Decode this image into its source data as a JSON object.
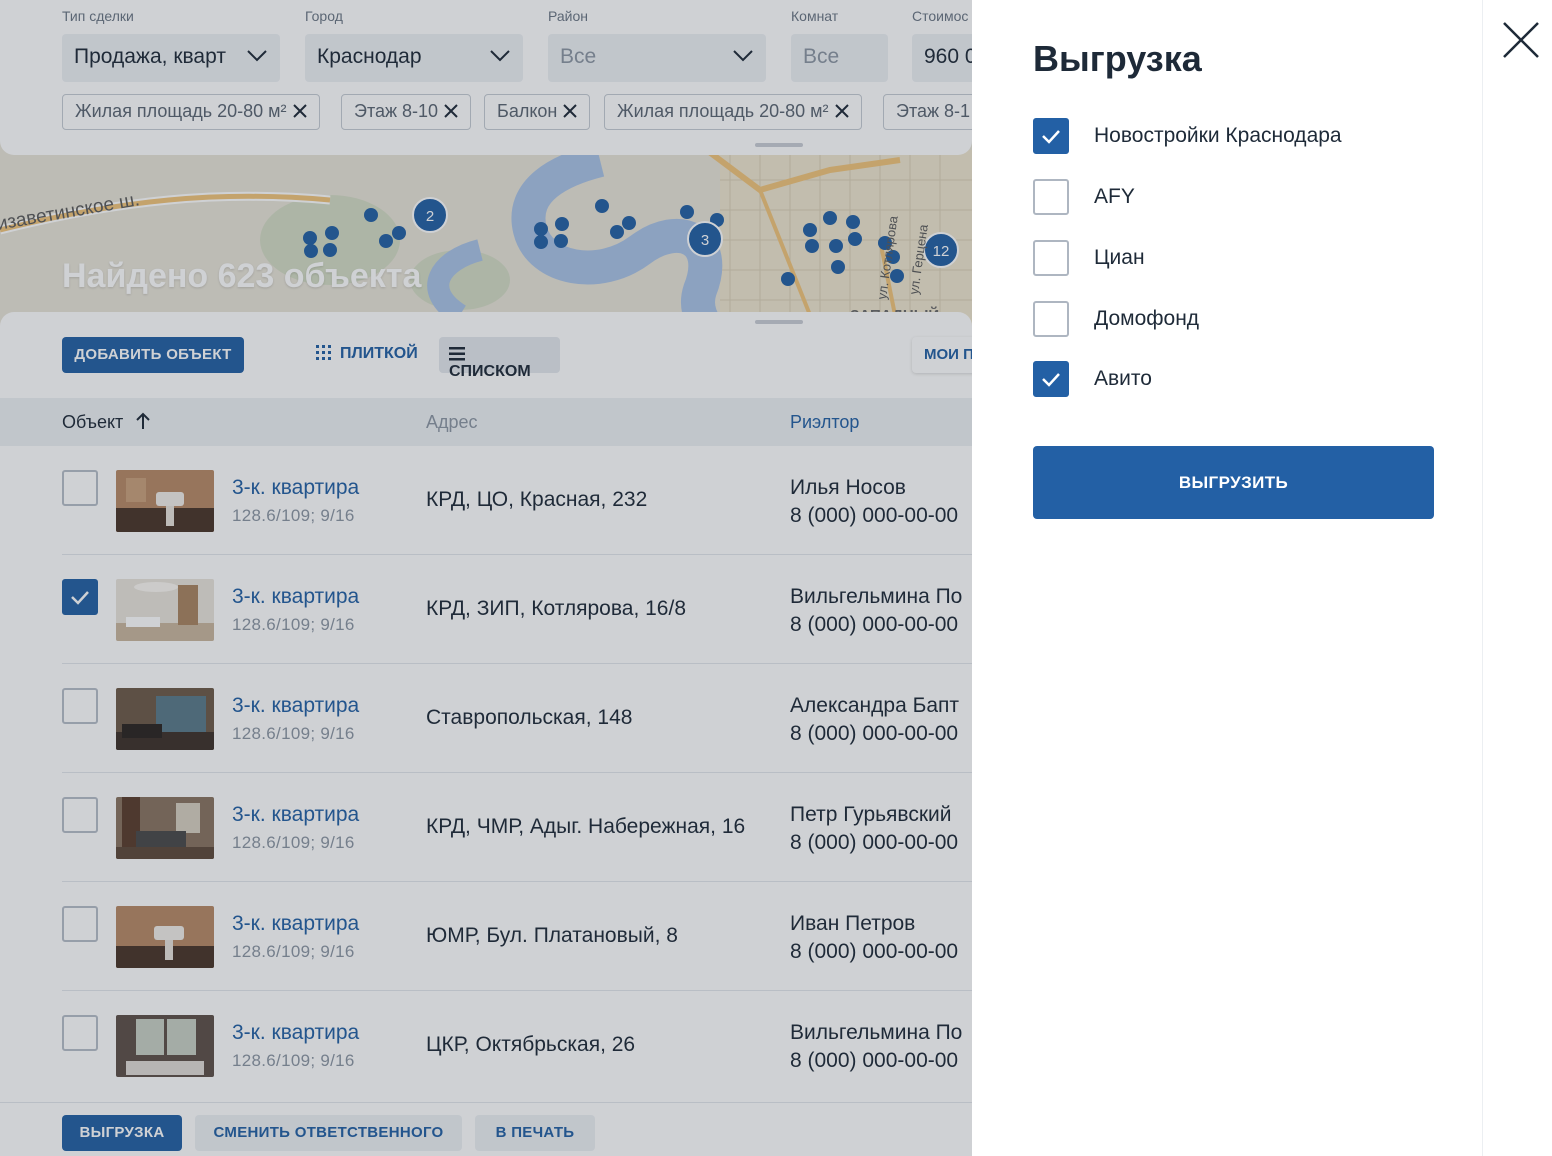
{
  "filters": {
    "deal_type": {
      "label": "Тип сделки",
      "value": "Продажа, кварт"
    },
    "city": {
      "label": "Город",
      "value": "Краснодар"
    },
    "district": {
      "label": "Район",
      "value": "Все"
    },
    "rooms": {
      "label": "Комнат",
      "value": "Все"
    },
    "price": {
      "label": "Стоимос",
      "value": "960 0"
    },
    "chips": [
      "Жилая площадь 20-80 м²",
      "Этаж 8-10",
      "Балкон",
      "Жилая площадь 20-80 м²",
      "Этаж 8-1"
    ]
  },
  "map": {
    "street_label": "изаветинское ш.",
    "street_label_2": "ул. Котлярова",
    "street_label_3": "ул. Герцена",
    "district_label": "ЗАПАДНЫЙ",
    "clusters": [
      "2",
      "3",
      "12"
    ]
  },
  "found_text": "Найдено 623 объекта",
  "toolbar": {
    "add_object": "ДОБАВИТЬ ОБЪЕКТ",
    "view_tiles": "ПЛИТКОЙ",
    "view_list": "СПИСКОМ",
    "my_label": "МОИ П"
  },
  "table": {
    "columns": {
      "object": "Объект",
      "address": "Адрес",
      "realtor": "Риэлтор"
    },
    "rows": [
      {
        "title": "3-к. квартира",
        "sub": "128.6/109; 9/16",
        "address": "КРД, ЦО, Красная, 232",
        "realtor": "Илья Носов",
        "phone": "8 (000) 000-00-00",
        "checked": false
      },
      {
        "title": "3-к. квартира",
        "sub": "128.6/109; 9/16",
        "address": "КРД, ЗИП, Котлярова, 16/8",
        "realtor": "Вильгельмина По",
        "phone": "8 (000) 000-00-00",
        "checked": true
      },
      {
        "title": "3-к. квартира",
        "sub": "128.6/109; 9/16",
        "address": "Ставропольская, 148",
        "realtor": "Александра Бапт",
        "phone": "8 (000) 000-00-00",
        "checked": false
      },
      {
        "title": "3-к. квартира",
        "sub": "128.6/109; 9/16",
        "address": "КРД, ЧМР, Адыг. Набережная, 16",
        "realtor": "Петр Гурьявский",
        "phone": "8 (000) 000-00-00",
        "checked": false
      },
      {
        "title": "3-к. квартира",
        "sub": "128.6/109; 9/16",
        "address": "ЮМР, Бул. Платановый, 8",
        "realtor": "Иван Петров",
        "phone": "8 (000) 000-00-00",
        "checked": false
      },
      {
        "title": "3-к. квартира",
        "sub": "128.6/109; 9/16",
        "address": "ЦКР, Октябрьская, 26",
        "realtor": "Вильгельмина По",
        "phone": "8 (000) 000-00-00",
        "checked": false
      }
    ]
  },
  "bottom": {
    "export": "ВЫГРУЗКА",
    "change_responsible": "СМЕНИТЬ ОТВЕТСТВЕННОГО",
    "print": "В ПЕЧАТЬ"
  },
  "drawer": {
    "title": "Выгрузка",
    "options": [
      {
        "label": "Новостройки Краснодара",
        "checked": true
      },
      {
        "label": "AFY",
        "checked": false
      },
      {
        "label": "Циан",
        "checked": false
      },
      {
        "label": "Домофонд",
        "checked": false
      },
      {
        "label": "Авито",
        "checked": true
      }
    ],
    "submit": "ВЫГРУЗИТЬ"
  },
  "colors": {
    "primary": "#2360a5",
    "text": "#1e2a38",
    "muted": "#8c96a3",
    "overlay": "rgba(36,44,58,0.22)"
  }
}
